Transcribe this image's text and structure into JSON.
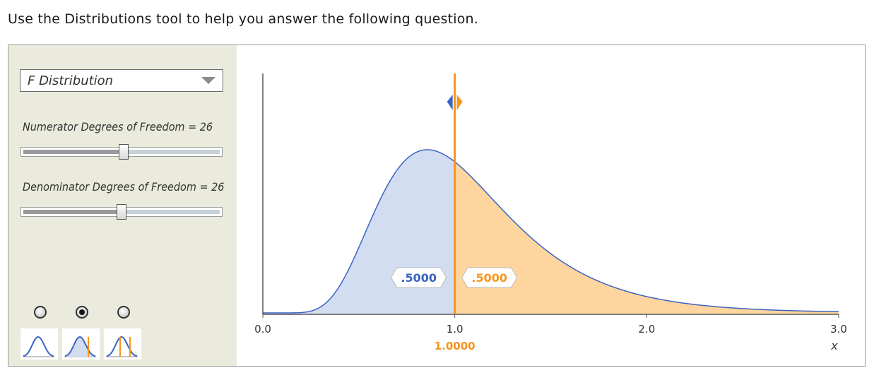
{
  "instruction": "Use the Distributions tool to help you answer the following question.",
  "controls": {
    "distribution_select": {
      "value": "F Distribution"
    },
    "numerator_slider": {
      "label": "Numerator Degrees of Freedom = 26",
      "value_fraction": 0.51
    },
    "denominator_slider": {
      "label": "Denominator Degrees of Freedom = 26",
      "value_fraction": 0.5
    },
    "modes": [
      {
        "name": "density-only",
        "selected": false
      },
      {
        "name": "single-cutoff",
        "selected": true
      },
      {
        "name": "two-cutoffs",
        "selected": false
      }
    ]
  },
  "colors": {
    "left_fill": "#d3ddf2",
    "right_fill": "#fed59e",
    "curve": "#3a64c3",
    "marker": "#f7941d",
    "left_label": "#3a64c3",
    "right_label": "#f7941d"
  },
  "chart_data": {
    "type": "area",
    "distribution": "F",
    "df1": 26,
    "df2": 26,
    "xlim": [
      0,
      3.0
    ],
    "x_ticks": [
      "0.0",
      "1.0",
      "2.0",
      "3.0"
    ],
    "xlabel": "x",
    "cutoff": 1.0,
    "cutoff_label": "1.0000",
    "left_area_label": ".5000",
    "right_area_label": ".5000"
  }
}
